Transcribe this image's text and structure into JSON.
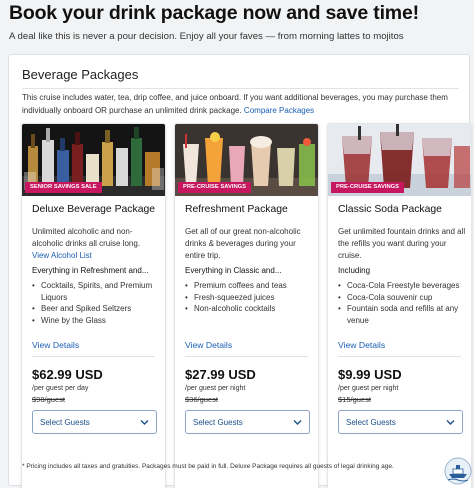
{
  "page": {
    "title": "Book your drink package now and save time!",
    "subtitle": "A deal like this is never a pour decision. Enjoy all your faves — from morning lattes to mojitos"
  },
  "panel": {
    "title": "Beverage Packages",
    "intro_text": "This cruise includes water, tea, drip coffee, and juice onboard. If you want additional beverages, you may purchase them individually onboard OR purchase an unlimited drink package.",
    "compare_link": "Compare Packages"
  },
  "cards": [
    {
      "badge": "SENIOR SAVINGS SALE",
      "title": "Deluxe Beverage Package",
      "description": "Unlimited alcoholic and non-alcoholic drinks all cruise long.",
      "link": "View Alcohol List",
      "includes_heading": "Everything in Refreshment and...",
      "items": [
        "Cocktails, Spirits, and Premium Liquors",
        "Beer and Spiked Seltzers",
        "Wine by the Glass"
      ],
      "details_link": "View Details",
      "price": "$62.99 USD",
      "per": "/per guest per day",
      "original_price": "$98/guest",
      "select_label": "Select Guests"
    },
    {
      "badge": "PRE-CRUISE SAVINGS",
      "title": "Refreshment Package",
      "description": "Get all of our great non-alcoholic drinks & beverages during your entire trip.",
      "link": "",
      "includes_heading": "Everything in Classic and...",
      "items": [
        "Premium coffees and teas",
        "Fresh-squeezed juices",
        "Non-alcoholic cocktails"
      ],
      "details_link": "View Details",
      "price": "$27.99 USD",
      "per": "/per guest per night",
      "original_price": "$36/guest",
      "select_label": "Select Guests"
    },
    {
      "badge": "PRE-CRUISE SAVINGS",
      "title": "Classic Soda Package",
      "description": "Get unlimited fountain drinks and all the refills you want during your cruise.",
      "link": "",
      "includes_heading": "Including",
      "items": [
        "Coca-Cola Freestyle beverages",
        "Coca-Cola souvenir cup",
        "Fountain soda and refills at any venue"
      ],
      "details_link": "View Details",
      "price": "$9.99 USD",
      "per": "/per guest per night",
      "original_price": "$15/guest",
      "select_label": "Select Guests"
    }
  ],
  "footnote": "* Pricing includes all taxes and gratuities. Packages must be paid in full. Deluxe Package requires all guests of legal drinking age.",
  "colors": {
    "badge": "#c7175e",
    "link": "#1a5fb4",
    "select_border": "#8aa3c2"
  },
  "icons": [
    "chevron-down-icon",
    "cruise-logo-icon"
  ]
}
